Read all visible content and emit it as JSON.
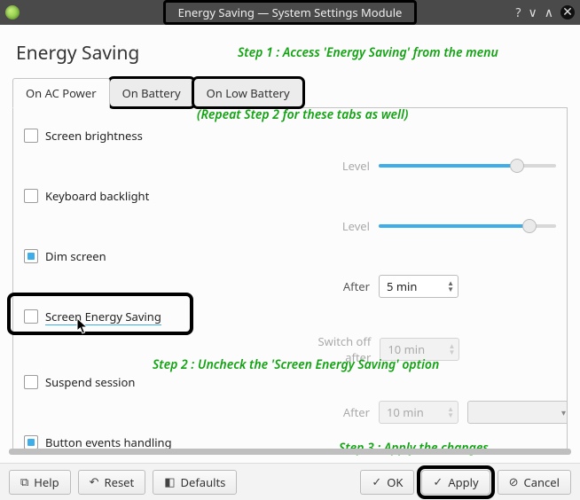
{
  "window": {
    "title": "Energy Saving — System Settings Module"
  },
  "page": {
    "heading": "Energy Saving"
  },
  "tabs": {
    "ac": "On AC Power",
    "battery": "On Battery",
    "low_battery": "On Low Battery"
  },
  "options": {
    "screen_brightness": {
      "label": "Screen brightness",
      "checked": false
    },
    "keyboard_backlight": {
      "label": "Keyboard backlight",
      "checked": false
    },
    "dim_screen": {
      "label": "Dim screen",
      "checked": true
    },
    "screen_energy_saving": {
      "label": "Screen Energy Saving",
      "checked": false
    },
    "suspend_session": {
      "label": "Suspend session",
      "checked": false
    },
    "button_events": {
      "label": "Button events handling",
      "checked": true
    }
  },
  "controls": {
    "level_label": "Level",
    "after_label": "After",
    "switch_off_label": "Switch off after",
    "dim_after_value": "5 min",
    "switch_off_value": "10 min",
    "suspend_after_value": "10 min",
    "brightness_slider_pct": 78,
    "backlight_slider_pct": 85
  },
  "footer": {
    "help": "Help",
    "reset": "Reset",
    "defaults": "Defaults",
    "ok": "OK",
    "apply": "Apply",
    "cancel": "Cancel"
  },
  "annotations": {
    "step1": "Step 1 : Access 'Energy Saving' from the menu",
    "step2_repeat": "(Repeat Step 2 for these tabs as well)",
    "step2": "Step 2 : Uncheck the 'Screen Energy Saving' option",
    "step3": "Step 3 : Apply the changes"
  }
}
